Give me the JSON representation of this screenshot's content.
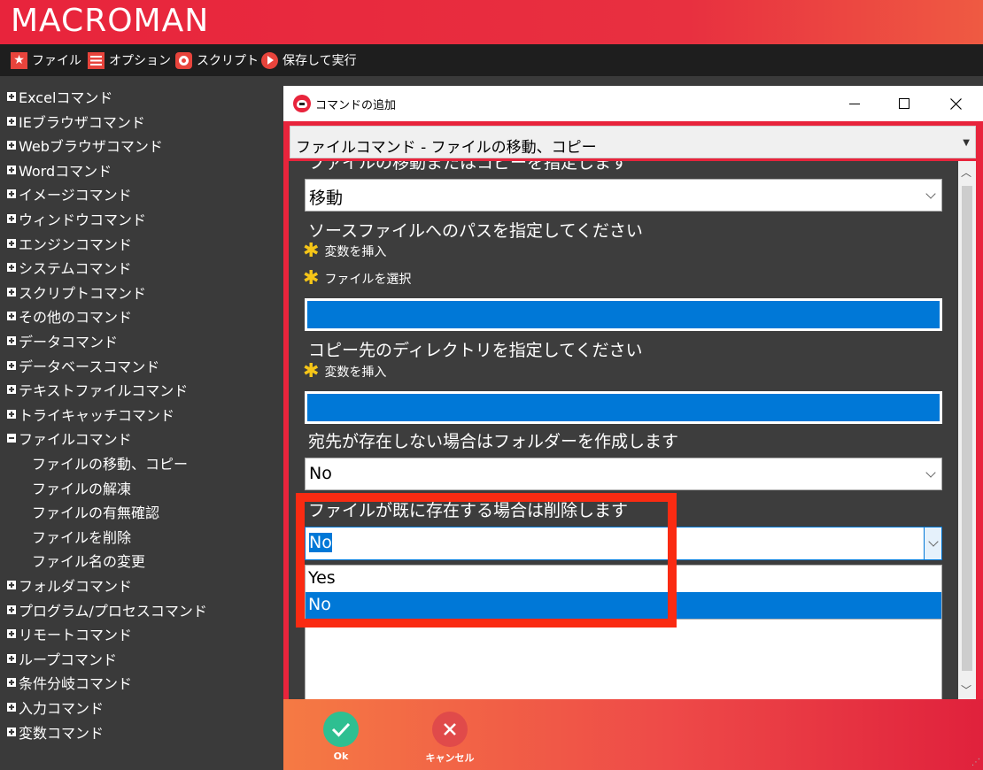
{
  "app": {
    "title": "MACROMAN"
  },
  "menu": [
    {
      "label": "ファイル",
      "icon": "star-icon"
    },
    {
      "label": "オプション",
      "icon": "menu-lines-icon"
    },
    {
      "label": "スクリプト",
      "icon": "script-icon"
    },
    {
      "label": "保存して実行",
      "icon": "play-icon"
    }
  ],
  "sidebar": {
    "categories": [
      "Excelコマンド",
      "IEブラウザコマンド",
      "Webブラウザコマンド",
      "Wordコマンド",
      "イメージコマンド",
      "ウィンドウコマンド",
      "エンジンコマンド",
      "システムコマンド",
      "スクリプトコマンド",
      "その他のコマンド",
      "データコマンド",
      "データベースコマンド",
      "テキストファイルコマンド",
      "トライキャッチコマンド",
      "ファイルコマンド"
    ],
    "file_subitems": [
      "ファイルの移動、コピー",
      "ファイルの解凍",
      "ファイルの有無確認",
      "ファイルを削除",
      "ファイル名の変更"
    ],
    "categories_after": [
      "フォルダコマンド",
      "プログラム/プロセスコマンド",
      "リモートコマンド",
      "ループコマンド",
      "条件分岐コマンド",
      "入力コマンド",
      "変数コマンド"
    ]
  },
  "dialog": {
    "title": "コマンドの追加",
    "command_select": "ファイルコマンド - ファイルの移動、コピー",
    "fields": {
      "operation_label": "ファイルの移動またはコピーを指定します",
      "operation_value": "移動",
      "source_label": "ソースファイルへのパスを指定してください",
      "insert_variable": "変数を挿入",
      "select_file": "ファイルを選択",
      "dest_label": "コピー先のディレクトリを指定してください",
      "create_folder_label": "宛先が存在しない場合はフォルダーを作成します",
      "create_folder_value": "No",
      "delete_existing_label": "ファイルが既に存在する場合は削除します",
      "delete_existing_value": "No",
      "delete_existing_options": [
        "Yes",
        "No"
      ]
    },
    "buttons": {
      "ok": "Ok",
      "cancel": "キャンセル"
    }
  },
  "colors": {
    "accent": "#e8243c",
    "selection": "#0078d7",
    "highlight": "#fa2b12",
    "ok": "#2ebf91",
    "cancel": "#e04a4a"
  }
}
